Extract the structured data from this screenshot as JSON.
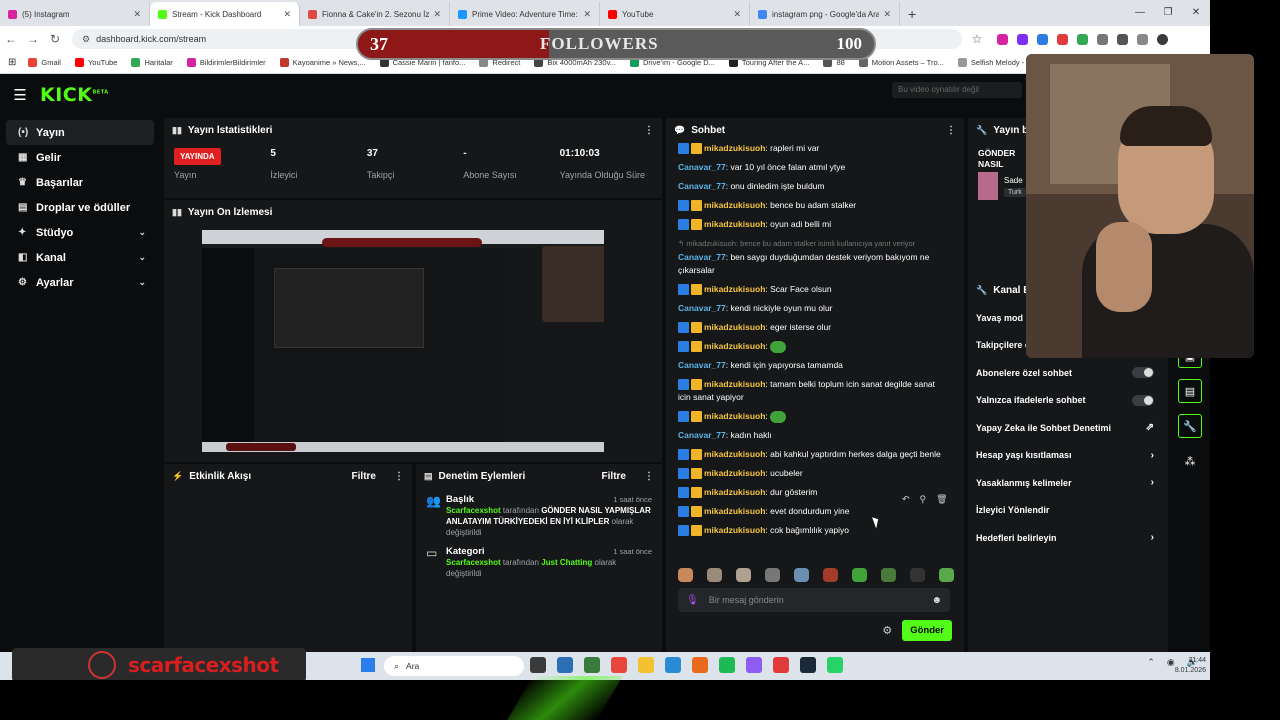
{
  "browser": {
    "tabs": [
      {
        "title": "(5) Instagram",
        "color": "#d6249f"
      },
      {
        "title": "Stream - Kick Dashboard",
        "color": "#53fc18"
      },
      {
        "title": "Fionna & Cake'in 2. Sezonu İzle",
        "color": "#e04848"
      },
      {
        "title": "Prime Video: Adventure Time: F",
        "color": "#1a98ff"
      },
      {
        "title": "YouTube",
        "color": "#ff0000"
      },
      {
        "title": "instagram png - Google'da Ara",
        "color": "#4285f4"
      }
    ],
    "new_tab": "+",
    "url": "dashboard.kick.com/stream",
    "bookmarks": [
      {
        "label": "Gmail",
        "color": "#ea4335"
      },
      {
        "label": "YouTube",
        "color": "#ff0000"
      },
      {
        "label": "Haritalar",
        "color": "#34a853"
      },
      {
        "label": "BildirimlerBildirimler",
        "color": "#d6249f"
      },
      {
        "label": "Kayoanime » News,...",
        "color": "#c0392b"
      },
      {
        "label": "Cassie Marin | fanfo...",
        "color": "#333333"
      },
      {
        "label": "Redirect",
        "color": "#888888"
      },
      {
        "label": "Bix 4000mAh 230v...",
        "color": "#444444"
      },
      {
        "label": "Drive'ım - Google D...",
        "color": "#0f9d58"
      },
      {
        "label": "Touring After the A...",
        "color": "#222222"
      },
      {
        "label": "88",
        "color": "#555555"
      },
      {
        "label": "Motion Assets – Tro...",
        "color": "#666666"
      },
      {
        "label": "Selfish Melody - Wa...",
        "color": "#999999"
      }
    ]
  },
  "followers_overlay": {
    "current": "37",
    "label": "FOLLOWERS",
    "goal": "100",
    "progress": 0.37
  },
  "kick": {
    "logo": "KICK",
    "logo_sup": "BETA",
    "notice": "Bu video oynatılır değil",
    "sidebar": [
      {
        "label": "Yayın",
        "icon": "(•)",
        "chev": ""
      },
      {
        "label": "Gelir",
        "icon": "▦",
        "chev": ""
      },
      {
        "label": "Başarılar",
        "icon": "♛",
        "chev": ""
      },
      {
        "label": "Droplar ve ödüller",
        "icon": "▤",
        "chev": ""
      },
      {
        "label": "Stüdyo",
        "icon": "✦",
        "chev": "⌄"
      },
      {
        "label": "Kanal",
        "icon": "◧",
        "chev": "⌄"
      },
      {
        "label": "Ayarlar",
        "icon": "⚙",
        "chev": "⌄"
      }
    ],
    "stats_panel": {
      "title": "Yayın İstatistikleri",
      "live_badge": "YAYINDA",
      "items": [
        {
          "value": "",
          "label": "Yayın"
        },
        {
          "value": "5",
          "label": "İzleyici"
        },
        {
          "value": "37",
          "label": "Takipçi"
        },
        {
          "value": "-",
          "label": "Abone Sayısı"
        },
        {
          "value": "01:10:03",
          "label": "Yayında Olduğu Süre"
        }
      ]
    },
    "preview_panel": {
      "title": "Yayın Ön İzlemesi"
    },
    "activity_panel": {
      "title": "Etkinlik Akışı",
      "filter": "Filtre"
    },
    "moderation_panel": {
      "title": "Denetim Eylemleri",
      "filter": "Filtre",
      "items": [
        {
          "title": "Başlık",
          "time": "1 saat önce",
          "user": "Scarfacexshot",
          "mid": " tarafından ",
          "value": "GÖNDER NASIL YAPMIŞLAR ANLATAYIM TÜRKİYEDEKİ EN İYİ KLİPLER",
          "tail": " olarak değiştirildi"
        },
        {
          "title": "Kategori",
          "time": "1 saat önce",
          "user": "Scarfacexshot",
          "mid": " tarafından ",
          "value": "Just Chatting",
          "tail": " olarak değiştirildi"
        }
      ]
    },
    "chat_panel": {
      "title": "Sohbet",
      "messages": [
        {
          "user": "mikadzukisuoh",
          "badges": true,
          "text": ": rapleri mi var"
        },
        {
          "user": "Canavar_77",
          "badges": false,
          "text": ": var 10 yıl önce falan atmıl ytye"
        },
        {
          "user": "Canavar_77",
          "badges": false,
          "text": ": onu dinledim işte buldum"
        },
        {
          "user": "mikadzukisuoh",
          "badges": true,
          "text": ": bence bu adam stalker"
        },
        {
          "user": "mikadzukisuoh",
          "badges": true,
          "text": ": oyun adi belli mi"
        },
        {
          "reply": "↰ mikadzukisuoh: bence bu adam stalker isimli kullanıcıya yanıt veriyor"
        },
        {
          "user": "Canavar_77",
          "badges": false,
          "text": ": ben saygı duyduğumdan destek veriyom bakıyom ne çıkarsalar"
        },
        {
          "user": "mikadzukisuoh",
          "badges": true,
          "text": ": Scar Face olsun"
        },
        {
          "user": "Canavar_77",
          "badges": false,
          "text": ": kendi nickiyle oyun mu olur"
        },
        {
          "user": "mikadzukisuoh",
          "badges": true,
          "text": ": eger isterse olur"
        },
        {
          "user": "mikadzukisuoh",
          "badges": true,
          "text": ":",
          "emoji": true
        },
        {
          "user": "Canavar_77",
          "badges": false,
          "text": ": kendi için yapıyorsa tamamda"
        },
        {
          "user": "mikadzukisuoh",
          "badges": true,
          "text": ": tamam belki toplum icin sanat degilde sanat icin sanat yapiyor"
        },
        {
          "user": "mikadzukisuoh",
          "badges": true,
          "text": ":",
          "emoji": true
        },
        {
          "user": "Canavar_77",
          "badges": false,
          "text": ": kadın haklı"
        },
        {
          "user": "mikadzukisuoh",
          "badges": true,
          "text": ": abi kahkul yaptırdım herkes dalga geçti benle"
        },
        {
          "user": "mikadzukisuoh",
          "badges": true,
          "text": ": ucubeler"
        },
        {
          "user": "mikadzukisuoh",
          "badges": true,
          "text": ": dur gösterim"
        },
        {
          "user": "mikadzukisuoh",
          "badges": true,
          "text": ": evet dondurdum yine"
        },
        {
          "user": "mikadzukisuoh",
          "badges": true,
          "text": ": cok bağımlılık yapiyo"
        }
      ],
      "emote_colors": [
        "#c9875c",
        "#9a8a7a",
        "#b0a090",
        "#777777",
        "#6a8fb0",
        "#a33b2a",
        "#3fa33a",
        "#4a7a3a",
        "#333333",
        "#59a84a"
      ],
      "input_placeholder": "Bir mesaj gönderin",
      "send": "Gönder"
    },
    "info_panel": {
      "title": "Yayın bilgileri",
      "stream_title": "GÖNDER NASIL YAPMIŞLAR ANLATAYIM TÜRKİYEDEKİ EN İYİ KLİPLER",
      "category": "Sade",
      "tag": "Turk"
    },
    "channel_panel": {
      "title": "Kanal Eylemleri",
      "rows": [
        {
          "label": "Yavaş mod",
          "type": "toggle"
        },
        {
          "label": "Takipçilere özel",
          "type": "toggle"
        },
        {
          "label": "Abonelere özel sohbet",
          "type": "toggle"
        },
        {
          "label": "Yalnızca ifadelerle sohbet",
          "type": "toggle"
        },
        {
          "label": "Yapay Zeka ile Sohbet Denetimi",
          "type": "ext"
        },
        {
          "label": "Hesap yaşı kısıtlaması",
          "type": "arrow"
        },
        {
          "label": "Yasaklanmış kelimeler",
          "type": "arrow"
        },
        {
          "label": "İzleyici Yönlendir",
          "type": "none"
        },
        {
          "label": "Hedefleri belirleyin",
          "type": "arrow"
        }
      ]
    }
  },
  "taskbar": {
    "watermark": "scarfacexshot",
    "search": "Ara",
    "time": "21:44",
    "date": "8.01.2026",
    "icon_colors": [
      "#3a3a3a",
      "#2c6fb5",
      "#3a7a3a",
      "#e8453c",
      "#f2c230",
      "#2a8ad4",
      "#e86a1a",
      "#1db954",
      "#8c5cf5",
      "#e03a3a",
      "#1b2838",
      "#25d366"
    ]
  }
}
